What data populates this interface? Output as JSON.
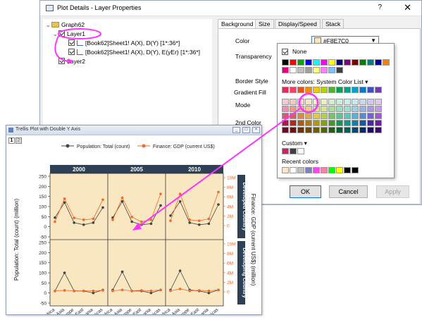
{
  "dialog": {
    "title": "Plot Details - Layer Properties",
    "help": "?",
    "close": "✕",
    "tree": {
      "root": "Graph62",
      "layer1": "Layer1",
      "plot1": "[Book62]Sheet1! A(X), D(Y) [1*:36*]",
      "plot2": "[Book62]Sheet1! A(X), D(Y), E(yEr) [1*:36*]",
      "layer2": "Layer2"
    },
    "tabs": [
      "Background",
      "Size",
      "Display/Speed",
      "Stack"
    ],
    "fields": {
      "color_label": "Color",
      "color_value": "#F8E7C0",
      "transparency_label": "Transparency",
      "border_style_label": "Border Style",
      "gradient_fill_label": "Gradient Fill",
      "mode_label": "Mode",
      "second_color_label": "2nd Color"
    },
    "buttons": {
      "ok": "OK",
      "cancel": "Cancel",
      "apply": "Apply"
    }
  },
  "color_popup": {
    "none_label": "None",
    "more_colors_label": "More colors: System Color List",
    "custom_label": "Custom",
    "recent_label": "Recent colors",
    "row1": [
      "#000000",
      "#ff0000",
      "#00aa00",
      "#0000ff",
      "#00ffff",
      "#ff00ff",
      "#ffff00",
      "#000080",
      "#800080",
      "#800000",
      "#008000",
      "#008080",
      "#0000a0",
      "#ff8000"
    ],
    "row2": [
      "#e0007a",
      "#ffffff",
      "#c0c0c0",
      "#a0a0a0",
      "#ffff80",
      "#ff80ff",
      "#80c0ff",
      "#404040"
    ],
    "system_row": [
      "#e8285a",
      "#ff3c64",
      "#e85020",
      "#f08c00",
      "#f0c800",
      "#b4d200",
      "#50b428",
      "#00a050",
      "#00a08c",
      "#00a0c8",
      "#0078d2",
      "#3c50c8",
      "#6e3cb4"
    ],
    "palette": [
      [
        "#f8c8d8",
        "#f8c8c0",
        "#f8d8c0",
        "#f8e7c0",
        "#f8f0c0",
        "#e8f0c0",
        "#d0f0c8",
        "#c8f0d8",
        "#c8f0e8",
        "#c8e8f0",
        "#c8d8f0",
        "#d0c8f0",
        "#e0c8f0"
      ],
      [
        "#f090b0",
        "#f09888",
        "#f0b088",
        "#f0c888",
        "#f0e088",
        "#d0e888",
        "#a8e098",
        "#98e0b8",
        "#98e0d8",
        "#98d0e8",
        "#98b0e8",
        "#a898e8",
        "#c898e8"
      ],
      [
        "#e05080",
        "#e06050",
        "#e08848",
        "#e0a848",
        "#e0c848",
        "#b0d048",
        "#70c860",
        "#58c890",
        "#58c8c0",
        "#58b0d8",
        "#5888d8",
        "#7860d8",
        "#a058d8"
      ],
      [
        "#b01848",
        "#b02818",
        "#b05810",
        "#b07810",
        "#b09810",
        "#80a010",
        "#409828",
        "#109858",
        "#109890",
        "#1080a8",
        "#1058a8",
        "#4828a8",
        "#7018a8"
      ],
      [
        "#700828",
        "#701008",
        "#703000",
        "#704800",
        "#706000",
        "#506800",
        "#206010",
        "#006030",
        "#006058",
        "#004870",
        "#002870",
        "#200870",
        "#400870"
      ]
    ],
    "custom_row": [
      "#d0206a",
      "#404040",
      "#ffffff"
    ],
    "recent_row": [
      "#f8e7c0",
      "#ffffff",
      "#c0c0c0",
      "#8080c0",
      "#ff40ff",
      "#ff80a0",
      "#00ff00",
      "#ffff00",
      "#000000",
      "#000000"
    ]
  },
  "graph_window": {
    "title": "Trellis Plot with Double Y Axis",
    "layer_tabs": [
      "1",
      "2"
    ]
  },
  "colors": {
    "plot_bg": "#f8e7c0",
    "header_bg": "#2d4055",
    "series1": "#444444",
    "series2": "#f06a28",
    "arrow": "#ff33ff",
    "accent": "#0078d7"
  },
  "chart_data": {
    "type": "line",
    "panels": [
      "2000",
      "2005",
      "2010"
    ],
    "rows": [
      "Developed Country",
      "Developing Country"
    ],
    "categories": [
      "Africa",
      "Asia",
      "Europe",
      "Middle East",
      "Oceania",
      "The Americas"
    ],
    "legend": [
      "Population: Total (count)",
      "Finance: GDP (current US$)"
    ],
    "ylabel_left": "Population: Total (count) (million)",
    "ylabel_right": "Finance: GDP (current US$) (million)",
    "left_ticks": [
      "250",
      "200",
      "150",
      "100",
      "50",
      "0",
      "-50"
    ],
    "right_ticks": [
      "10M",
      "8M",
      "6M",
      "4M",
      "2M",
      "0"
    ],
    "left_ylim": [
      -50,
      250
    ],
    "right_ylim": [
      0,
      10
    ],
    "series": [
      {
        "name": "Population: Total (count)",
        "values": {
          "Developed Country": [
            [
              45,
              120,
              20,
              10,
              20,
              95
            ],
            [
              45,
              125,
              25,
              10,
              15,
              105
            ],
            [
              55,
              125,
              20,
              10,
              15,
              110
            ]
          ],
          "Developing Country": [
            [
              10,
              100,
              10,
              10,
              0,
              15
            ],
            [
              15,
              105,
              10,
              10,
              0,
              15
            ],
            [
              15,
              110,
              15,
              10,
              0,
              15
            ]
          ]
        }
      },
      {
        "name": "Finance: GDP (current US$)",
        "values": {
          "Developed Country": [
            [
              0.8,
              5.6,
              1.6,
              1.2,
              1.4,
              5.4
            ],
            [
              1.2,
              5.8,
              1.8,
              0.8,
              1.2,
              6.6
            ],
            [
              1.0,
              6.6,
              1.2,
              1.0,
              1.4,
              7.0
            ]
          ],
          "Developing Country": [
            [
              0.2,
              0.3,
              0.2,
              0.2,
              0.2,
              0.3
            ],
            [
              0.2,
              0.4,
              0.2,
              0.3,
              0.2,
              0.4
            ],
            [
              0.2,
              0.6,
              0.2,
              0.3,
              0.2,
              0.4
            ]
          ]
        }
      }
    ]
  }
}
